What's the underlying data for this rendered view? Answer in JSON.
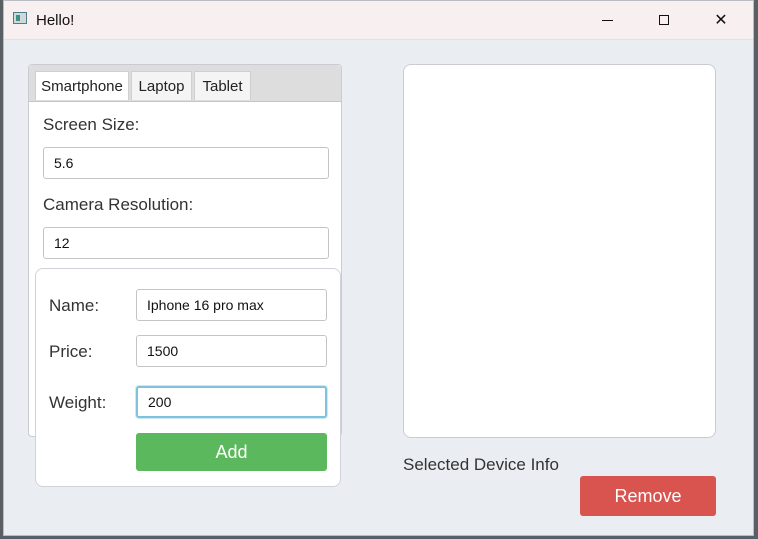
{
  "window": {
    "title": "Hello!"
  },
  "tabs": [
    {
      "label": "Smartphone"
    },
    {
      "label": "Laptop"
    },
    {
      "label": "Tablet"
    }
  ],
  "smartphone": {
    "screen_size_label": "Screen Size:",
    "screen_size_value": "5.6",
    "camera_label": "Camera Resolution:",
    "camera_value": "12"
  },
  "form": {
    "name_label": "Name:",
    "name_value": "Iphone 16 pro max",
    "price_label": "Price:",
    "price_value": "1500",
    "weight_label": "Weight:",
    "weight_value": "200",
    "add_label": "Add"
  },
  "details": {
    "info_label": "Selected Device Info",
    "remove_label": "Remove"
  },
  "colors": {
    "add_button": "#5cb85c",
    "remove_button": "#d9534f",
    "focus_ring": "#7fc2dd"
  }
}
